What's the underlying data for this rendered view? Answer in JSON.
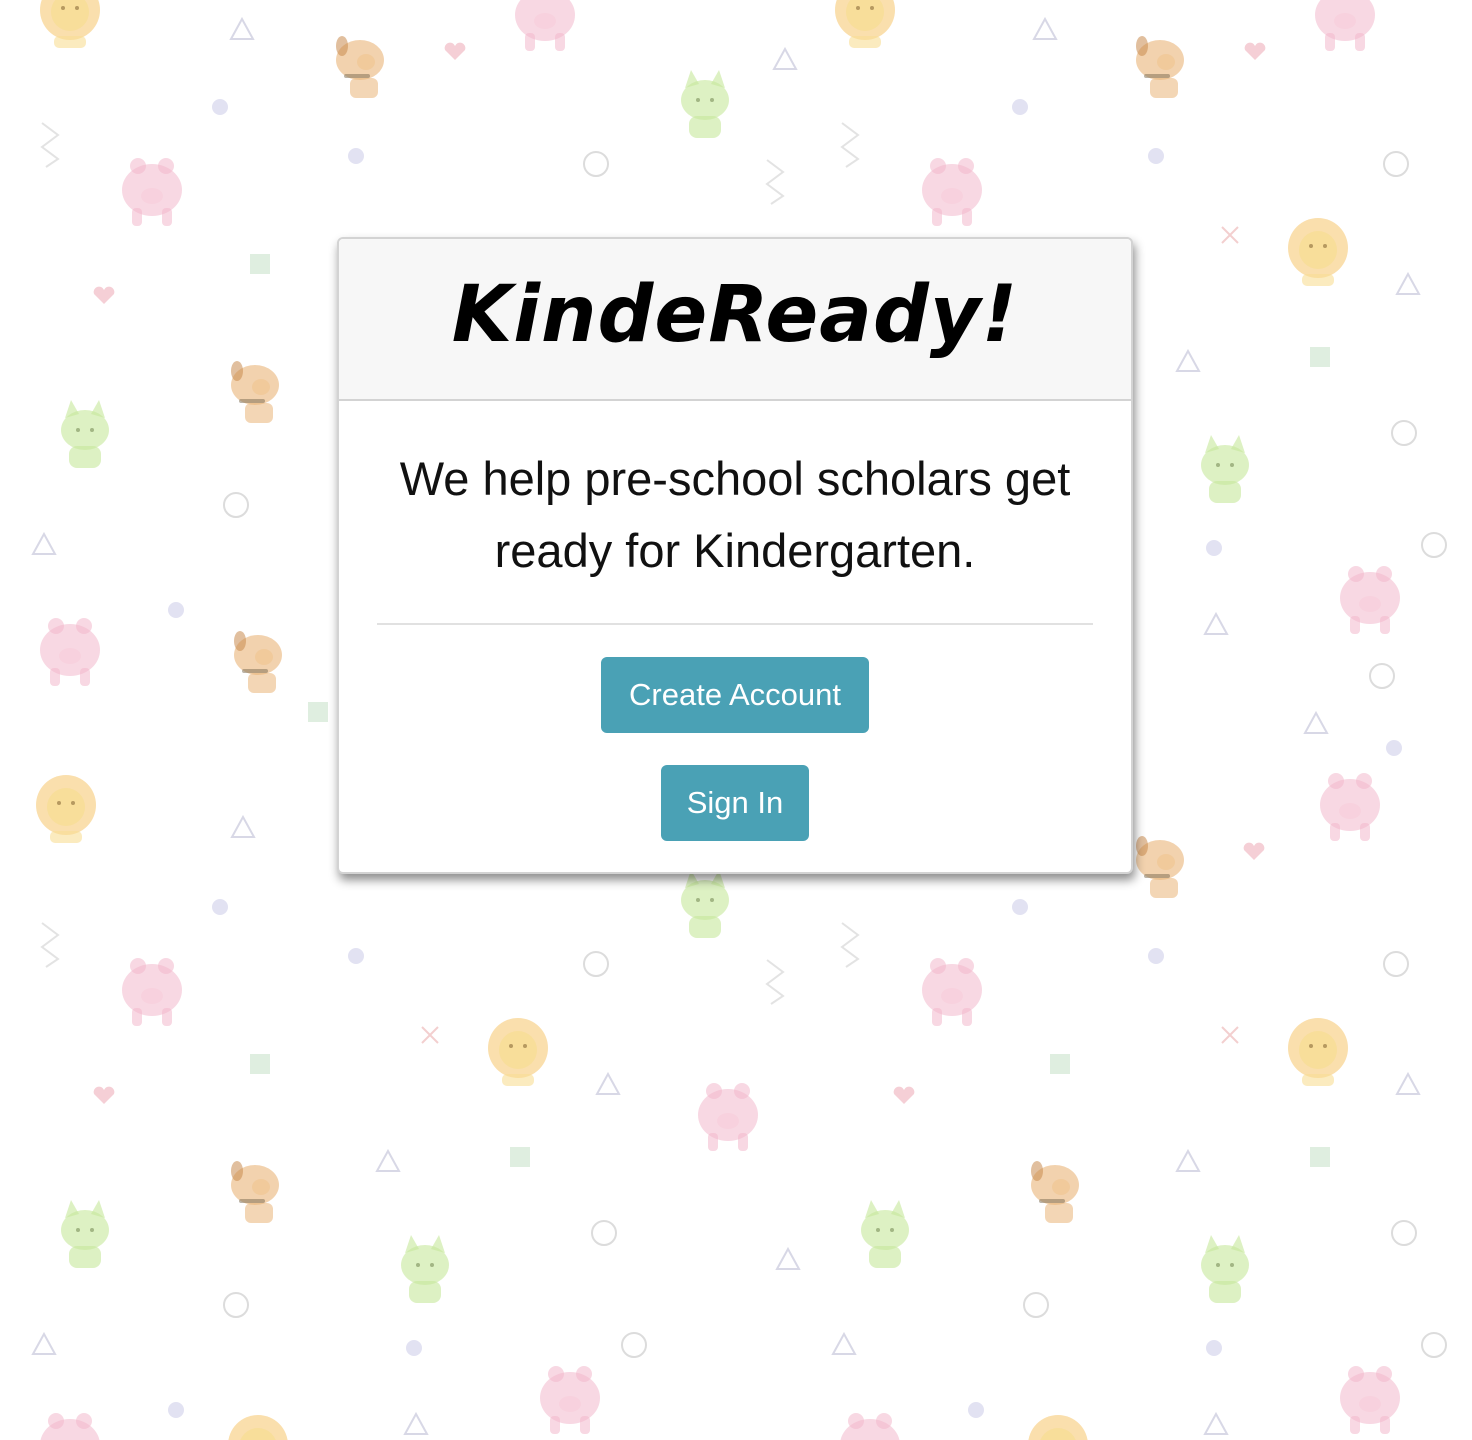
{
  "card": {
    "title": "KindeReady!",
    "tagline": "We help pre-school scholars get ready for Kindergarten.",
    "create_account_label": "Create Account",
    "sign_in_label": "Sign In"
  },
  "theme": {
    "button_color": "#4aa1b5",
    "header_background": "#f7f7f7",
    "page_background": "#ffffff"
  },
  "background": {
    "pattern": "pastel animal doodles",
    "icons": [
      "lion-icon",
      "dog-icon",
      "pig-icon",
      "cat-icon",
      "triangle-shape",
      "circle-shape",
      "square-shape",
      "heart-shape",
      "zigzag-shape",
      "cross-shape"
    ]
  }
}
